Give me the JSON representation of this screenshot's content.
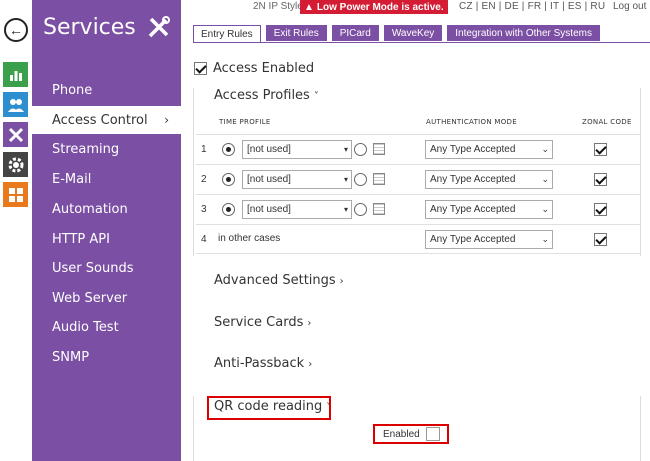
{
  "header": {
    "device_style": "2N IP Style",
    "alert_text": "Low Power Mode is active.",
    "alert_icon": "warning-icon",
    "languages": "CZ | EN | DE | FR | IT | ES | RU",
    "logout": "Log out"
  },
  "sidebar": {
    "title": "Services",
    "items": [
      {
        "label": "Phone",
        "active": false
      },
      {
        "label": "Access Control",
        "active": true
      },
      {
        "label": "Streaming",
        "active": false
      },
      {
        "label": "E-Mail",
        "active": false
      },
      {
        "label": "Automation",
        "active": false
      },
      {
        "label": "HTTP API",
        "active": false
      },
      {
        "label": "User Sounds",
        "active": false
      },
      {
        "label": "Web Server",
        "active": false
      },
      {
        "label": "Audio Test",
        "active": false
      },
      {
        "label": "SNMP",
        "active": false
      }
    ],
    "active_chevron": "›"
  },
  "tabs": [
    {
      "label": "Entry Rules",
      "active": true
    },
    {
      "label": "Exit Rules",
      "active": false
    },
    {
      "label": "PICard",
      "active": false
    },
    {
      "label": "WaveKey",
      "active": false
    },
    {
      "label": "Integration with Other Systems",
      "active": false
    }
  ],
  "access_enabled": {
    "label": "Access Enabled",
    "checked": true
  },
  "access_profiles": {
    "heading": "Access Profiles",
    "arrow": "˅",
    "columns": {
      "time_profile": "TIME PROFILE",
      "auth_mode": "AUTHENTICATION MODE",
      "zonal_code": "ZONAL CODE"
    },
    "rows": [
      {
        "num": "1",
        "time_profile": "[not used]",
        "auth_mode": "Any Type Accepted",
        "zonal": true
      },
      {
        "num": "2",
        "time_profile": "[not used]",
        "auth_mode": "Any Type Accepted",
        "zonal": true
      },
      {
        "num": "3",
        "time_profile": "[not used]",
        "auth_mode": "Any Type Accepted",
        "zonal": true
      },
      {
        "num": "4",
        "other_label": "in other cases",
        "auth_mode": "Any Type Accepted",
        "zonal": true
      }
    ]
  },
  "sections": {
    "advanced": "Advanced Settings",
    "service_cards": "Service Cards",
    "anti_passback": "Anti-Passback",
    "collapsed_arrow": "›"
  },
  "qr": {
    "heading": "QR code reading",
    "arrow": "˅",
    "enabled_label": "Enabled",
    "enabled_checked": false
  },
  "colors": {
    "brand": "#7b4fa3",
    "alert": "#d41d35",
    "highlight": "#dd0000"
  }
}
